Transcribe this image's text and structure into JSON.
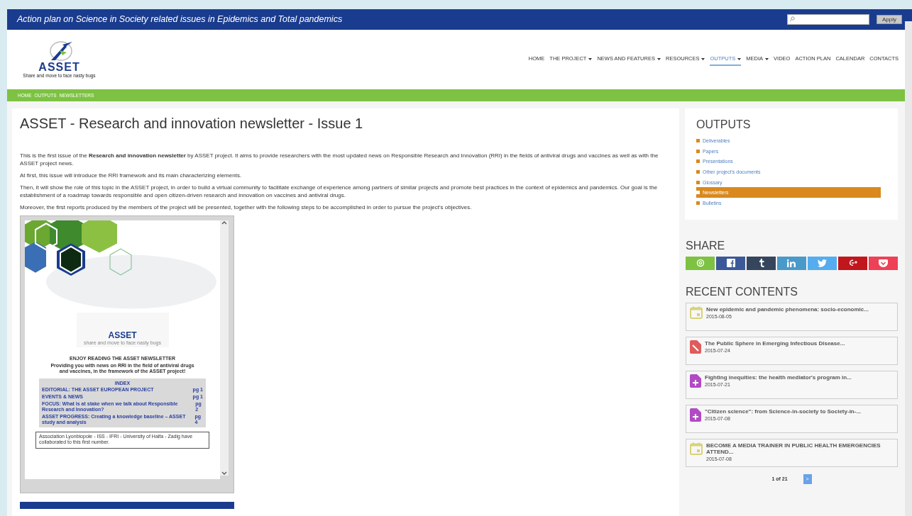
{
  "header": {
    "title": "Action plan on Science in Society related issues in Epidemics and Total pandemics",
    "apply_button": "Apply"
  },
  "logo": {
    "name": "ASSET",
    "tagline": "Share and move to face nasty bugs"
  },
  "nav": [
    {
      "label": "HOME",
      "dropdown": false,
      "selected": false
    },
    {
      "label": "THE PROJECT",
      "dropdown": true,
      "selected": false
    },
    {
      "label": "NEWS AND FEATURES",
      "dropdown": true,
      "selected": false
    },
    {
      "label": "RESOURCES",
      "dropdown": true,
      "selected": false
    },
    {
      "label": "OUTPUTS",
      "dropdown": true,
      "selected": true
    },
    {
      "label": "MEDIA",
      "dropdown": true,
      "selected": false
    },
    {
      "label": "VIDEO",
      "dropdown": false,
      "selected": false
    },
    {
      "label": "ACTION PLAN",
      "dropdown": false,
      "selected": false
    },
    {
      "label": "CALENDAR",
      "dropdown": false,
      "selected": false
    },
    {
      "label": "CONTACTS",
      "dropdown": false,
      "selected": false
    }
  ],
  "breadcrumb": [
    "HOME",
    "OUTPUTS",
    "NEWSLETTERS"
  ],
  "article": {
    "title": "ASSET - Research and innovation newsletter - Issue 1",
    "paragraphs": [
      "This is the first issue of the **Research and innovation newsletter** by ASSET project. It aims  to provide researchers with the most updated news on Responsible Research and Innovation (RRI) in the fields of antiviral drugs and vaccines as well as with the ASSET project news.",
      "At first, this issue will introduce the RRI framework and its main characterizing elements.",
      "Then, it will show the role of this topic  in the ASSET project, in order to build a virtual community to facilitate exchange of experience among partners of similar projects and promote best practices in the context of epidemics and pandemics. Our goal is the establishment of a roadmap towards responsible and open citizen-driven research and innovation on vaccines and antiviral drugs.",
      "Moreover, the first reports produced by the members of the project will be presented, together with the following steps to be accomplished in order to pursue the project's objectives."
    ]
  },
  "document": {
    "logo_name": "ASSET",
    "logo_tagline": "share and move to face nasty bugs",
    "heading": "ENJOY READING THE ASSET NEWSLETTER",
    "intro": "Providing you with news on RRI in the field of antiviral drugs and vaccines, in the framework of the ASSET project!",
    "index_title": "INDEX",
    "index": [
      {
        "entry": "EDITORIAL: THE ASSET EUROPEAN PROJECT",
        "page": "pg 1"
      },
      {
        "entry": "EVENTS & NEWS",
        "page": "pg 1"
      },
      {
        "entry": "FOCUS: What is at stake when we talk about Responsible Research and Innovation?",
        "page": "pg 2"
      },
      {
        "entry": "ASSET PROGRESS: Creating a knowledge baseline – ASSET study and analysis",
        "page": "pg 4"
      }
    ],
    "footer": "Association Lyonbiopole - ISS - IFRI - University of Haifa - Zadig have collaborated to this first number."
  },
  "sidebar": {
    "outputs_title": "OUTPUTS",
    "outputs": [
      {
        "label": "Deliverables",
        "selected": false
      },
      {
        "label": "Papers",
        "selected": false
      },
      {
        "label": "Presentations",
        "selected": false
      },
      {
        "label": "Other project's documents",
        "selected": false
      },
      {
        "label": "Glossary",
        "selected": false
      },
      {
        "label": "Newsletters",
        "selected": true
      },
      {
        "label": "Bulletins",
        "selected": false
      }
    ],
    "share_title": "SHARE",
    "share": [
      {
        "kind": "email",
        "color": "#7dc242"
      },
      {
        "kind": "facebook",
        "color": "#3b5998"
      },
      {
        "kind": "tumblr",
        "color": "#35465c"
      },
      {
        "kind": "linkedin",
        "color": "#4a9ac9"
      },
      {
        "kind": "twitter",
        "color": "#55acee"
      },
      {
        "kind": "googleplus",
        "color": "#c0161c"
      },
      {
        "kind": "pocket",
        "color": "#ee4056"
      }
    ],
    "recent_title": "RECENT CONTENTS",
    "recent": [
      {
        "kind": "event",
        "title": "New epidemic and pandemic phenomena: socio-economic...",
        "date": "2015-08-05"
      },
      {
        "kind": "paper",
        "title": "The Public Sphere in Emerging Infectious Disease...",
        "date": "2015-07-24"
      },
      {
        "kind": "news",
        "title": "Fighting inequities: the health mediator's program in...",
        "date": "2015-07-21"
      },
      {
        "kind": "news",
        "title": "\"Citizen science\": from Science-in-society to Society-in-...",
        "date": "2015-07-08"
      },
      {
        "kind": "event",
        "title": "BECOME A MEDIA TRAINER IN PUBLIC HEALTH EMERGENCIES ATTEND...",
        "date": "2015-07-08"
      }
    ],
    "pager": "1 of 21",
    "next": ">"
  }
}
